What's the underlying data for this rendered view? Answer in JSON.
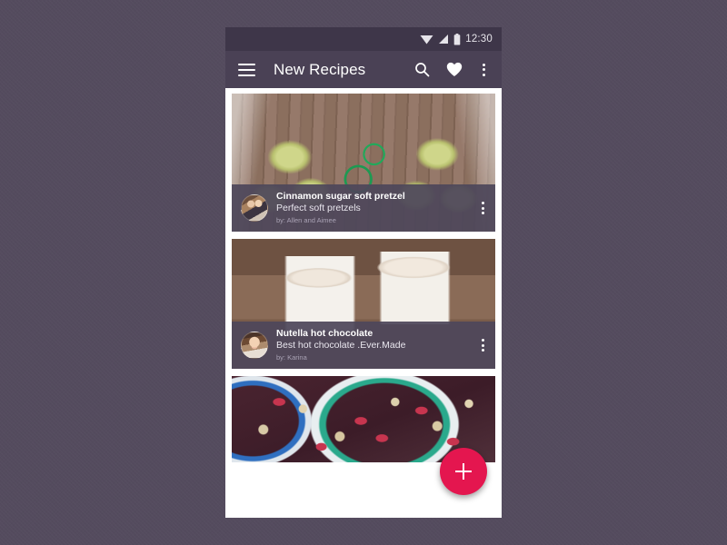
{
  "statusbar": {
    "time": "12:30",
    "icons": [
      "wifi-icon",
      "signal-icon",
      "battery-icon"
    ]
  },
  "appbar": {
    "title": "New Recipes",
    "menu_icon": "hamburger-icon",
    "search_icon": "search-icon",
    "favorite_icon": "heart-icon",
    "overflow_icon": "overflow-menu-icon",
    "background_color": "#4A4155"
  },
  "fab": {
    "label": "+",
    "icon": "plus-icon",
    "color": "#E4164F"
  },
  "colors": {
    "page_background": "#544B5E",
    "status_bar": "#3E3649",
    "app_bar": "#4A4155",
    "card_overlay": "#4E475A",
    "accent": "#E4164F"
  },
  "feed": {
    "cards": [
      {
        "title": "Cinnamon sugar soft pretzel",
        "subtitle": "Perfect soft pretzels",
        "author": "by: Allen and Aimee",
        "photo": "pretzels-on-wood-with-green-ribbon",
        "avatar": "avatar-allen-and-aimee",
        "menu_icon": "overflow-menu-icon"
      },
      {
        "title": "Nutella hot chocolate",
        "subtitle": "Best hot chocolate .Ever.Made",
        "author": "by: Karina",
        "photo": "two-mugs-of-hot-chocolate-with-marshmallows",
        "avatar": "avatar-karina",
        "menu_icon": "overflow-menu-icon"
      },
      {
        "title": "",
        "subtitle": "",
        "author": "",
        "photo": "granola-acai-bowls",
        "avatar": "",
        "menu_icon": ""
      }
    ]
  }
}
